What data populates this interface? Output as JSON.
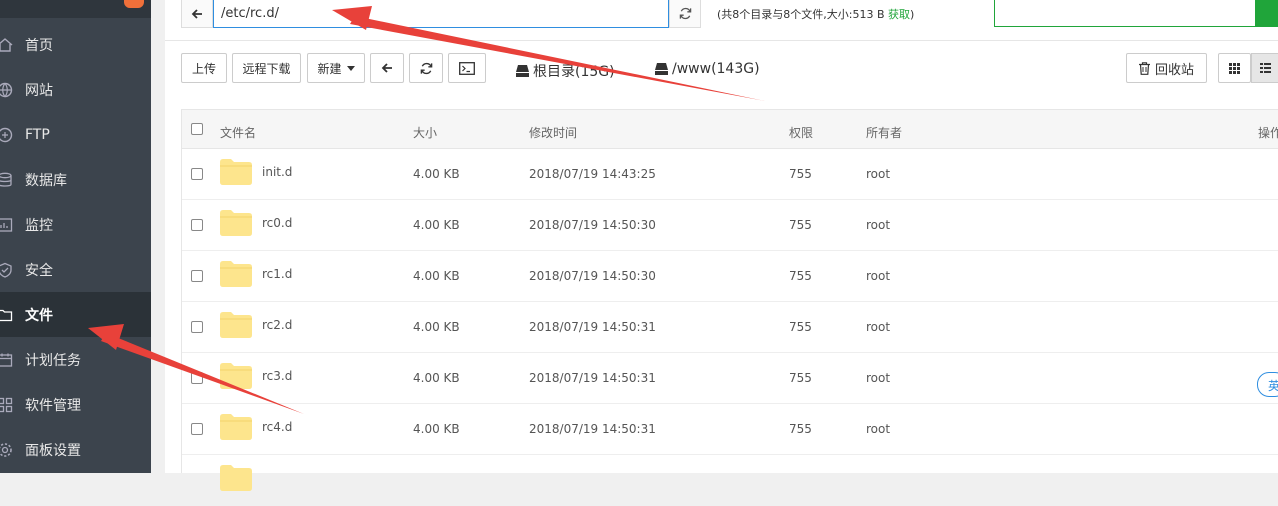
{
  "sidebar": {
    "items": [
      {
        "label": "首页",
        "icon": "home-icon"
      },
      {
        "label": "网站",
        "icon": "globe-icon"
      },
      {
        "label": "FTP",
        "icon": "ftp-icon"
      },
      {
        "label": "数据库",
        "icon": "database-icon"
      },
      {
        "label": "监控",
        "icon": "monitor-icon"
      },
      {
        "label": "安全",
        "icon": "shield-icon"
      },
      {
        "label": "文件",
        "icon": "folder-icon",
        "active": true
      },
      {
        "label": "计划任务",
        "icon": "calendar-icon"
      },
      {
        "label": "软件管理",
        "icon": "grid-icon"
      },
      {
        "label": "面板设置",
        "icon": "gear-icon"
      }
    ]
  },
  "topbar": {
    "path": "/etc/rc.d/",
    "summary": "(共8个目录与8个文件,大小:513 B ",
    "summary_link": "获取",
    "summary_end": ")"
  },
  "toolbar": {
    "upload": "上传",
    "remote_download": "远程下载",
    "new": "新建",
    "disk_root": "根目录(15G)",
    "disk_www": "/www(143G)",
    "recycle": "回收站"
  },
  "table": {
    "headers": {
      "name": "文件名",
      "size": "大小",
      "mtime": "修改时间",
      "perm": "权限",
      "owner": "所有者",
      "ops": "操作"
    },
    "rows": [
      {
        "name": "init.d",
        "size": "4.00 KB",
        "mtime": "2018/07/19 14:43:25",
        "perm": "755",
        "owner": "root"
      },
      {
        "name": "rc0.d",
        "size": "4.00 KB",
        "mtime": "2018/07/19 14:50:30",
        "perm": "755",
        "owner": "root"
      },
      {
        "name": "rc1.d",
        "size": "4.00 KB",
        "mtime": "2018/07/19 14:50:30",
        "perm": "755",
        "owner": "root"
      },
      {
        "name": "rc2.d",
        "size": "4.00 KB",
        "mtime": "2018/07/19 14:50:31",
        "perm": "755",
        "owner": "root"
      },
      {
        "name": "rc3.d",
        "size": "4.00 KB",
        "mtime": "2018/07/19 14:50:31",
        "perm": "755",
        "owner": "root"
      },
      {
        "name": "rc4.d",
        "size": "4.00 KB",
        "mtime": "2018/07/19 14:50:31",
        "perm": "755",
        "owner": "root"
      }
    ]
  },
  "ime_badge": "英",
  "colors": {
    "accent_green": "#20a53a",
    "accent_blue": "#2f8ee0",
    "sidebar_bg": "#3c444d",
    "annotation_red": "#e8413a",
    "folder_yellow": "#fde58d"
  }
}
